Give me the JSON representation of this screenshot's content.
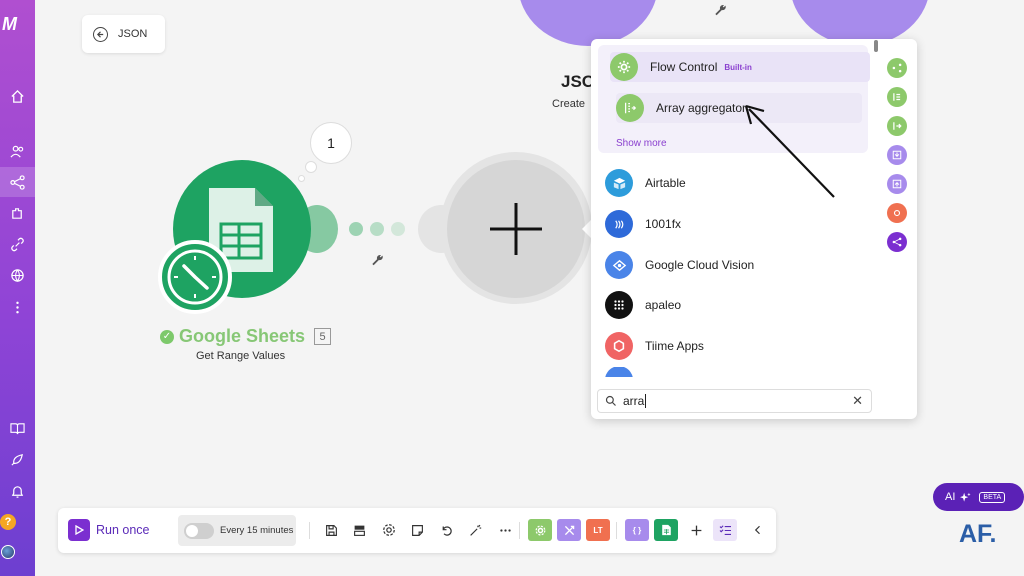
{
  "canvas": {
    "back_label": "JSON",
    "json_module": {
      "title": "JSO",
      "subtitle": "Create"
    },
    "google_sheets": {
      "badge_count": "1",
      "name": "Google Sheets",
      "id": "5",
      "action": "Get Range Values"
    }
  },
  "dropdown": {
    "group": [
      {
        "label": "Flow Control",
        "badge": "Built-in",
        "icon": "gear-icon",
        "color": "#8dc96b"
      },
      {
        "label": "Array aggregator",
        "icon": "array-aggregator-icon",
        "color": "#8dc96b"
      }
    ],
    "show_more": "Show more",
    "apps": [
      {
        "label": "Airtable",
        "icon": "airtable-icon",
        "color": "#2d9cdb"
      },
      {
        "label": "1001fx",
        "icon": "1001fx-icon",
        "color": "#2e6ad9"
      },
      {
        "label": "Google Cloud Vision",
        "icon": "google-cloud-vision-icon",
        "color": "#4a84e8"
      },
      {
        "label": "apaleo",
        "icon": "apaleo-icon",
        "color": "#111111"
      },
      {
        "label": "Tiime Apps",
        "icon": "tiime-icon",
        "color": "#f06464"
      }
    ],
    "search_value": "arra"
  },
  "toolbar": {
    "run_label": "Run once",
    "schedule_label": "Every 15 minutes",
    "log_badge": "LT",
    "json_badge": "{ }"
  },
  "ai": {
    "label": "AI",
    "beta": "BETA"
  },
  "watermark": "AF."
}
